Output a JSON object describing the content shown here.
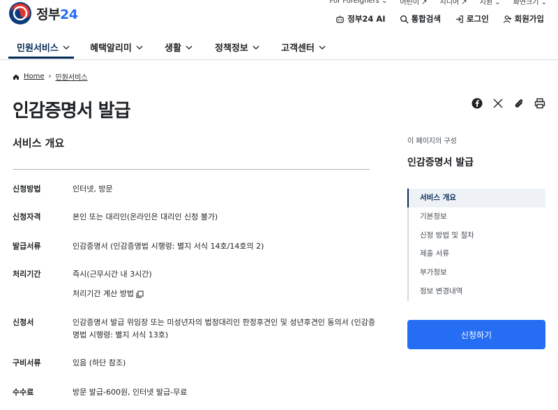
{
  "header": {
    "logo_text": "정부",
    "logo_num": "24",
    "util_links": [
      "For Foreigners ⌄",
      "어린이 ↗",
      "시니어 ↗",
      "지원 ⌄",
      "화면크기 ⌄"
    ],
    "actions": {
      "ai": "정부24 AI",
      "search": "통합검색",
      "login": "로그인",
      "signup": "회원가입"
    }
  },
  "gnb": {
    "items": [
      "민원서비스",
      "혜택알리미",
      "생활",
      "정책정보",
      "고객센터"
    ]
  },
  "breadcrumb": {
    "home": "Home",
    "current": "민원서비스"
  },
  "page_title": "인감증명서 발급",
  "section_title": "서비스 개요",
  "info": [
    {
      "label": "신청방법",
      "value": "인터넷, 방문"
    },
    {
      "label": "신청자격",
      "value": "본인 또는 대리인(온라인은 대리인 신청 불가)"
    },
    {
      "label": "발급서류",
      "value": "인감증명서 (인감증명법 시행령: 별지 서식 14호/14호의 2)"
    },
    {
      "label": "처리기간",
      "value": "즉시(근무시간 내 3시간)",
      "link": "처리기간 계산 방법"
    },
    {
      "label": "신청서",
      "value": "인감증명서 발급 위임장 또는 미성년자의 법정대리인 한정후견인 및 성년후견인 동의서 (인감증명법 시행령: 별지 서식 13호)"
    },
    {
      "label": "구비서류",
      "value": "있음 (하단 참조)"
    },
    {
      "label": "수수료",
      "value": "방문 발급-600원, 인터넷 발급-무료"
    }
  ],
  "sidebar": {
    "subtitle": "이 페이지의 구성",
    "title": "인감증명서 발급",
    "toc": [
      "서비스 개요",
      "기본정보",
      "신청 방법 및 절차",
      "제출 서류",
      "부가정보",
      "정보 변경내역"
    ],
    "apply_label": "신청하기"
  },
  "colors": {
    "primary": "#256ef4",
    "navy": "#052b57"
  }
}
